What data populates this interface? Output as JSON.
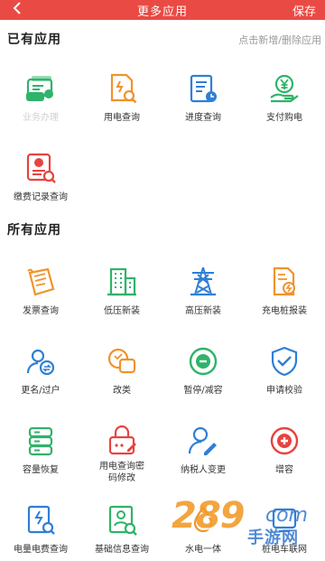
{
  "header": {
    "back_icon": "chevron-left-icon",
    "title": "更多应用",
    "save": "保存"
  },
  "owned": {
    "title": "已有应用",
    "hint": "点击新增/删除应用",
    "apps": [
      {
        "label": "业务办理",
        "icon": "business-card-icon",
        "disabled": true
      },
      {
        "label": "用电查询",
        "icon": "document-search-icon"
      },
      {
        "label": "进度查询",
        "icon": "progress-clock-icon"
      },
      {
        "label": "支付购电",
        "icon": "yen-hand-icon"
      },
      {
        "label": "缴费记录查询",
        "icon": "payment-record-icon"
      }
    ]
  },
  "all": {
    "title": "所有应用",
    "apps": [
      {
        "label": "发票查询",
        "icon": "invoice-scroll-icon"
      },
      {
        "label": "低压新装",
        "icon": "building-icon"
      },
      {
        "label": "高压新装",
        "icon": "power-tower-icon"
      },
      {
        "label": "充电桩报装",
        "icon": "charging-document-icon"
      },
      {
        "label": "更名/过户",
        "icon": "user-transfer-icon"
      },
      {
        "label": "改类",
        "icon": "speech-bubbles-icon"
      },
      {
        "label": "暂停/减容",
        "icon": "minus-circle-icon"
      },
      {
        "label": "申请校验",
        "icon": "shield-check-icon"
      },
      {
        "label": "容量恢复",
        "icon": "server-restore-icon"
      },
      {
        "label": "用电查询密码修改",
        "label_line1": "用电查询密",
        "label_line2": "码修改",
        "icon": "lock-edit-icon"
      },
      {
        "label": "纳税人变更",
        "icon": "user-edit-icon"
      },
      {
        "label": "增容",
        "icon": "plus-circle-icon"
      },
      {
        "label": "电量电费查询",
        "icon": "electricity-bill-icon"
      },
      {
        "label": "基础信息查询",
        "icon": "profile-card-icon"
      },
      {
        "label": "水电一体",
        "icon": "water-electric-icon"
      },
      {
        "label": "桩电车联网",
        "icon": "ev-network-icon"
      }
    ]
  },
  "watermark": {
    "number": "289",
    "suffix": "com",
    "text": "手游网"
  },
  "colors": {
    "header": "#ea4a44",
    "green": "#2fb36a",
    "orange": "#f0932b",
    "blue": "#2f7fd6",
    "red": "#e8433f"
  }
}
